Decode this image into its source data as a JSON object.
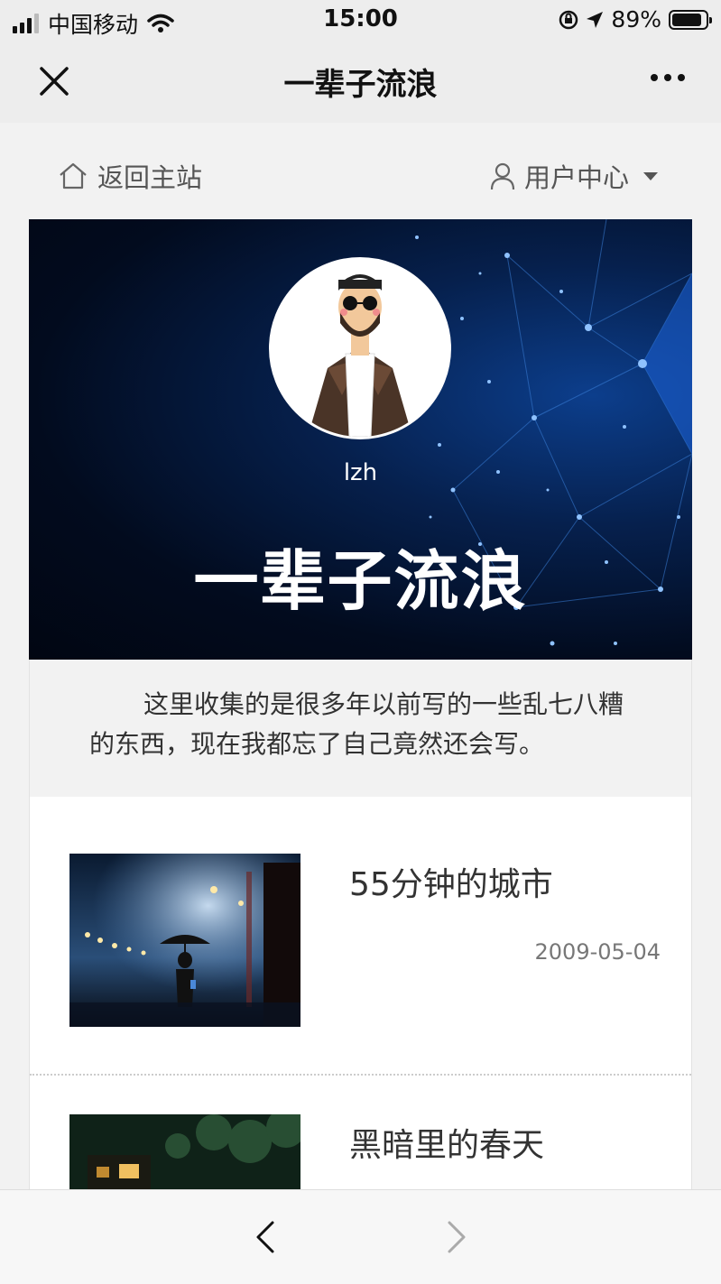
{
  "status_bar": {
    "carrier": "中国移动",
    "time": "15:00",
    "battery": "89%",
    "battery_level": 0.89
  },
  "nav": {
    "title": "一辈子流浪"
  },
  "top_links": {
    "home": "返回主站",
    "user_center": "用户中心"
  },
  "banner": {
    "username": "lzh",
    "title": "一辈子流浪"
  },
  "description": "这里收集的是很多年以前写的一些乱七八糟的东西，现在我都忘了自己竟然还会写。",
  "articles": [
    {
      "title": "55分钟的城市",
      "date": "2009-05-04"
    },
    {
      "title": "黑暗里的春天",
      "date": ""
    }
  ],
  "colors": {
    "page_bg": "#f2f2f2",
    "nav_bg": "#ededed",
    "banner_bg": "#020b1e",
    "banner_accent": "#3a8fff"
  }
}
